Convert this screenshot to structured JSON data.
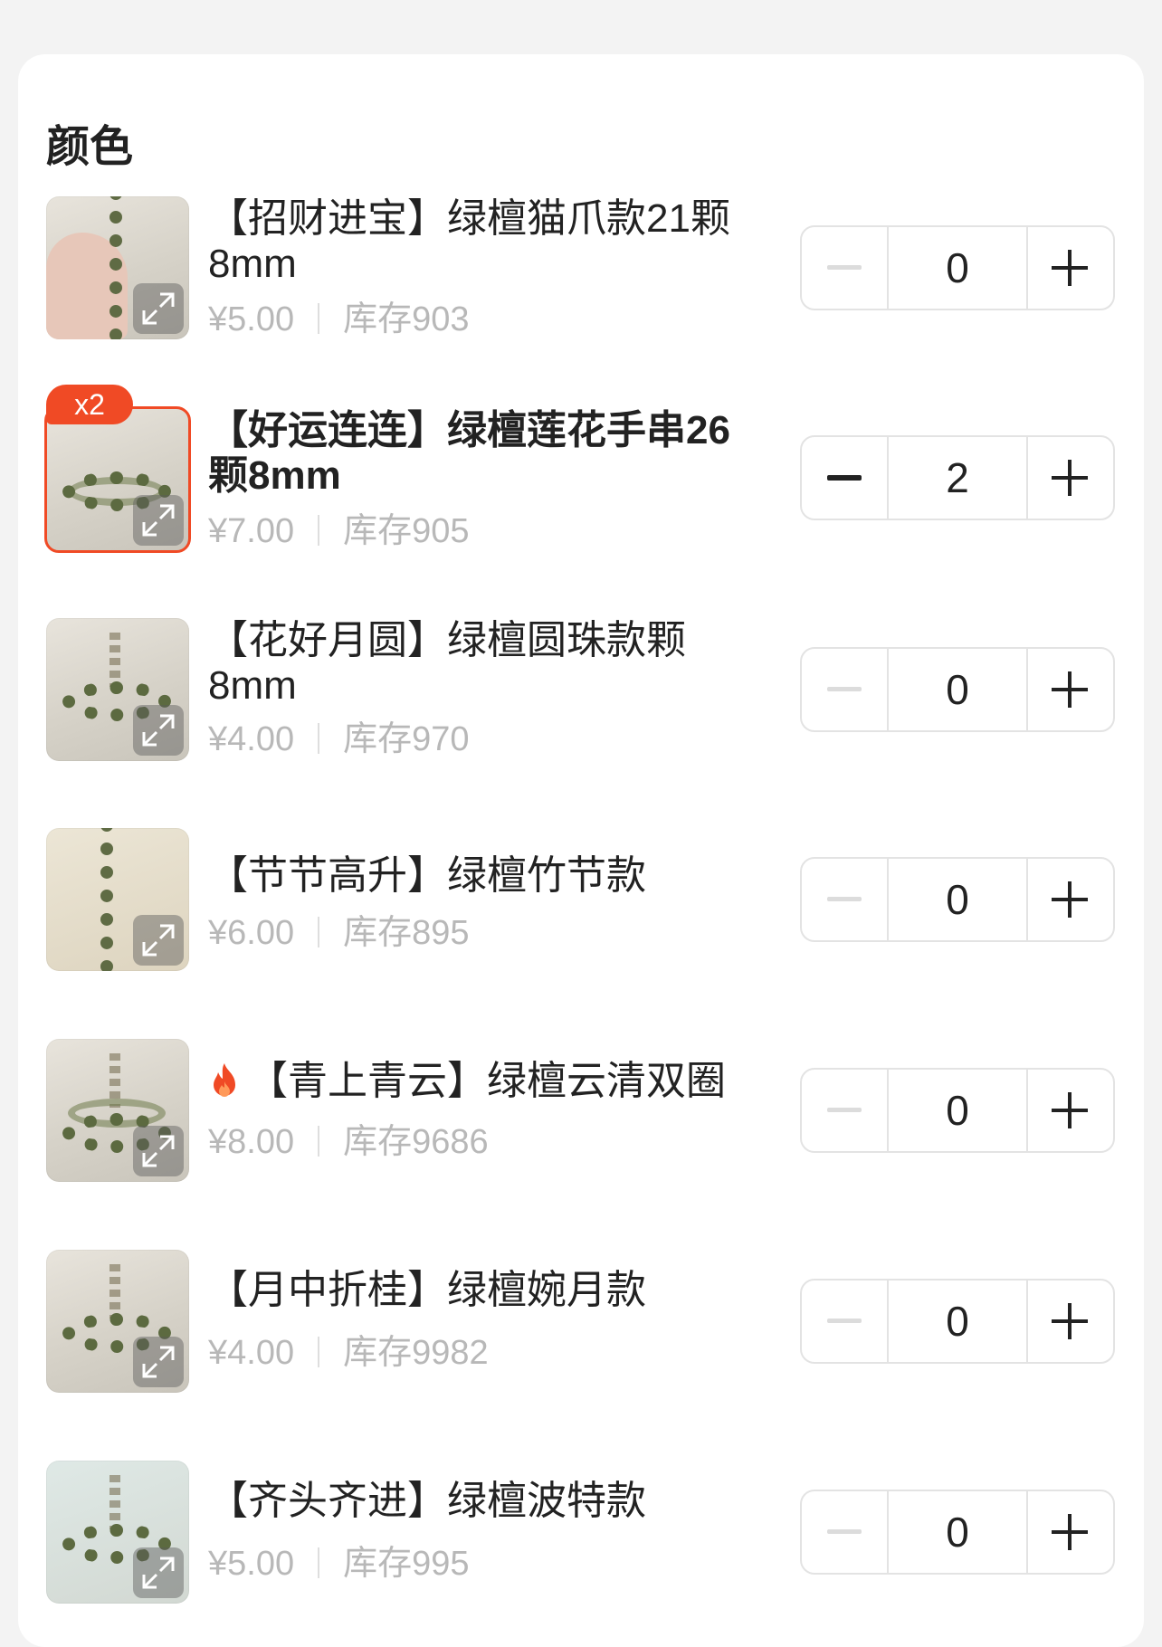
{
  "section": {
    "title": "颜色"
  },
  "items": [
    {
      "name": "【招财进宝】绿檀猫爪款21颗8mm",
      "price": "¥5.00",
      "stock": "库存903",
      "qty": "0"
    },
    {
      "name": "【好运连连】绿檀莲花手串26颗8mm",
      "price": "¥7.00",
      "stock": "库存905",
      "qty": "2",
      "badge": "x2"
    },
    {
      "name": "【花好月圆】绿檀圆珠款颗8mm",
      "price": "¥4.00",
      "stock": "库存970",
      "qty": "0"
    },
    {
      "name": "【节节高升】绿檀竹节款",
      "price": "¥6.00",
      "stock": "库存895",
      "qty": "0"
    },
    {
      "name": "【青上青云】绿檀云清双圈",
      "price": "¥8.00",
      "stock": "库存9686",
      "qty": "0",
      "icon": "fire-icon"
    },
    {
      "name": "【月中折桂】绿檀婉月款",
      "price": "¥4.00",
      "stock": "库存9982",
      "qty": "0"
    },
    {
      "name": "【齐头齐进】绿檀波特款",
      "price": "¥5.00",
      "stock": "库存995",
      "qty": "0"
    }
  ],
  "colors": {
    "accent": "#f04a25",
    "muted": "#b8b8b8"
  }
}
